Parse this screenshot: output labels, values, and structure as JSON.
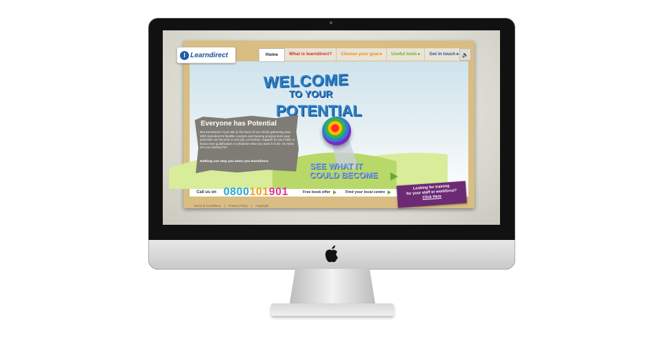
{
  "site": {
    "logo_text": "Learndirect",
    "logo_mark": "l"
  },
  "nav": {
    "home": "Home",
    "what": "What is learndirect?",
    "goal": "Choose your goal",
    "tools": "Useful tools",
    "touch": "Get in touch",
    "arrow": "▸"
  },
  "hero": {
    "line1": "WELCOME",
    "line2": "TO YOUR",
    "line3": "POTENTIAL",
    "cta_line1": "SEE WHAT IT",
    "cta_line2": "COULD BECOME"
  },
  "panel": {
    "title": "Everyone has Potential",
    "body": "But sometimes it just sits in the back of our minds gathering dust. With learndirect's flexible courses and training programmes your potential can become a new job, promotion, support for your kids, a brand new qualification or whatever else you want it to be. So what are you waiting for?",
    "tagline": "Nothing can stop you when you learndirect."
  },
  "bottom": {
    "call_label": "Call us on",
    "phone_part1": "0800",
    "phone_part2": "101",
    "phone_part3": "901",
    "book_offer": "Free book offer",
    "local_centre": "Find your local centre",
    "training_line1": "Looking for training",
    "training_line2": "for your staff or workforce?",
    "training_click": "Click Here"
  },
  "footer": {
    "terms": "Terms & Conditions",
    "sep": "|",
    "privacy": "Privacy Policy",
    "copyright": "Copyright"
  },
  "colors": {
    "brand_blue": "#1d4f97",
    "nav_red": "#d42a2a",
    "nav_orange": "#ee8a18",
    "nav_green": "#6bae2c",
    "nav_blue": "#2a4fa0",
    "training_purple": "#6d2a74"
  },
  "icons": {
    "speaker": "speaker-icon",
    "apple": "apple-logo-icon"
  }
}
